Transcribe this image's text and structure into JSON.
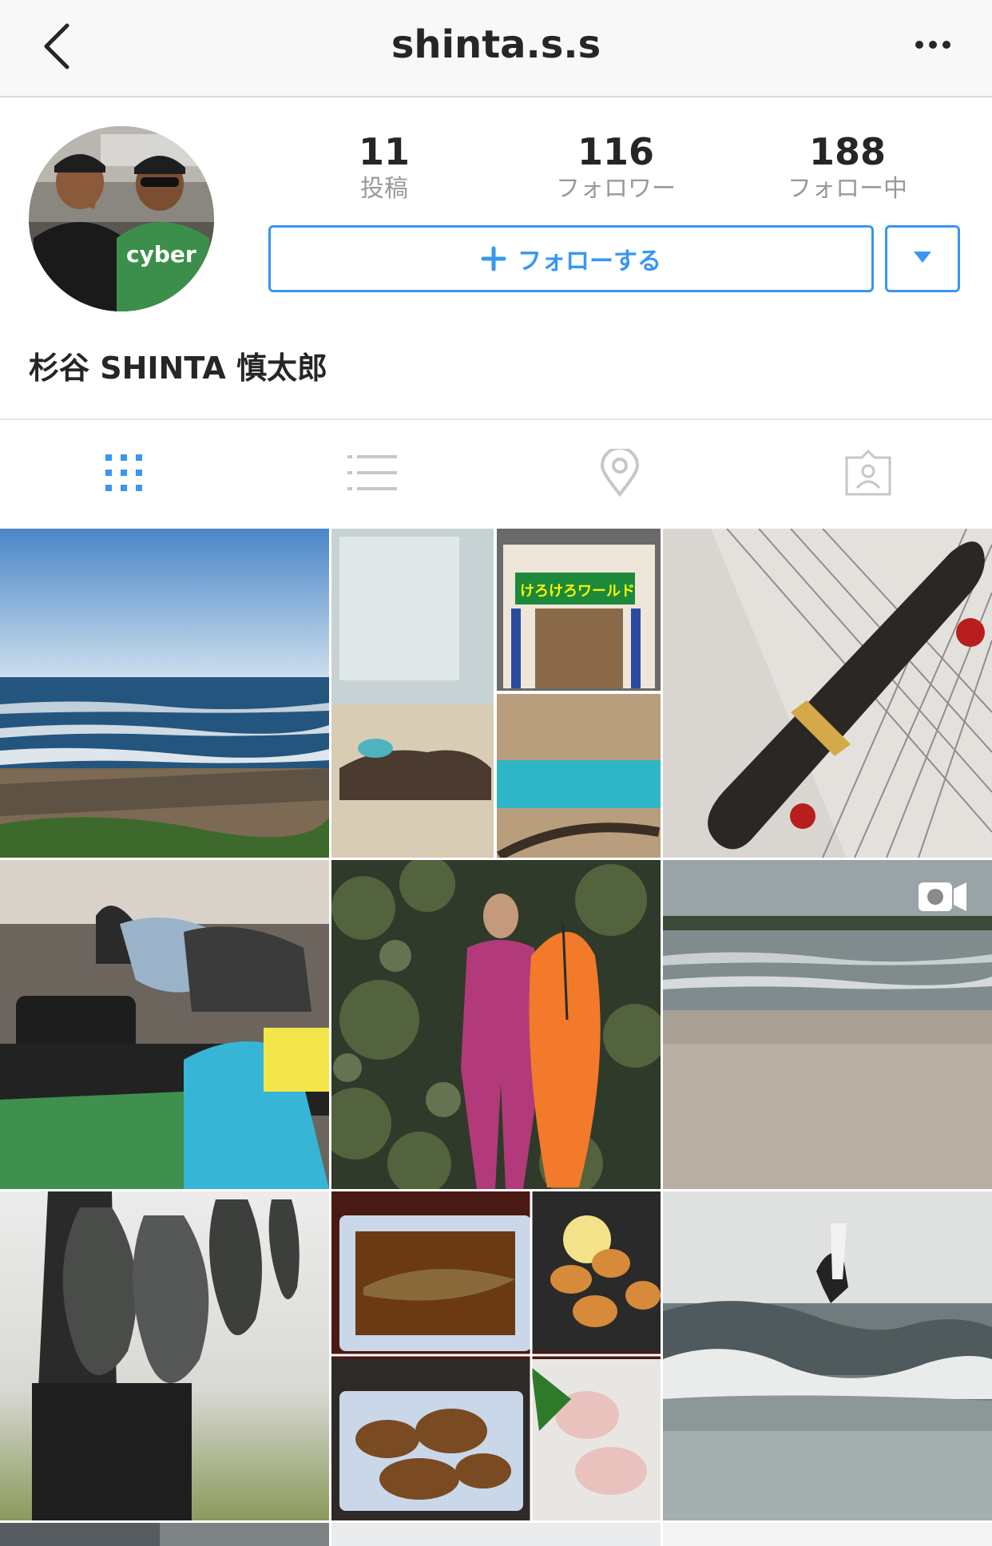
{
  "nav": {
    "back_icon": "chevron-left-icon",
    "title": "shinta.s.s",
    "more_icon": "more-horizontal-icon"
  },
  "profile": {
    "stats": [
      {
        "value": "11",
        "label": "投稿"
      },
      {
        "value": "116",
        "label": "フォロワー"
      },
      {
        "value": "188",
        "label": "フォロー中"
      }
    ],
    "follow_button": "フォローする",
    "follow_icon": "plus-icon",
    "dropdown_icon": "caret-down-icon",
    "name": "杉谷 SHINTA 慎太郎",
    "avatar_shirt_text": "cyber"
  },
  "tabs": [
    {
      "icon": "grid-icon",
      "active": true
    },
    {
      "icon": "list-icon",
      "active": false
    },
    {
      "icon": "location-pin-icon",
      "active": false
    },
    {
      "icon": "tagged-person-icon",
      "active": false
    }
  ],
  "colors": {
    "accent": "#3897f0",
    "text": "#262626",
    "muted": "#999999",
    "icon_inactive": "#c7c7c7",
    "navbar_bg": "#f8f8f8"
  },
  "posts": [
    {
      "subject": "ocean beach",
      "video": false
    },
    {
      "subject": "aquarium collage",
      "video": false,
      "sign_text": "けろけろワールド"
    },
    {
      "subject": "skateboard",
      "video": false
    },
    {
      "subject": "car trunk with gear",
      "video": false
    },
    {
      "subject": "surfer with orange board",
      "video": false
    },
    {
      "subject": "surf video",
      "video": true,
      "badge_icon": "video-camera-icon"
    },
    {
      "subject": "fish catch",
      "video": false
    },
    {
      "subject": "food collage",
      "video": false
    },
    {
      "subject": "surfer on wave",
      "video": false
    }
  ]
}
